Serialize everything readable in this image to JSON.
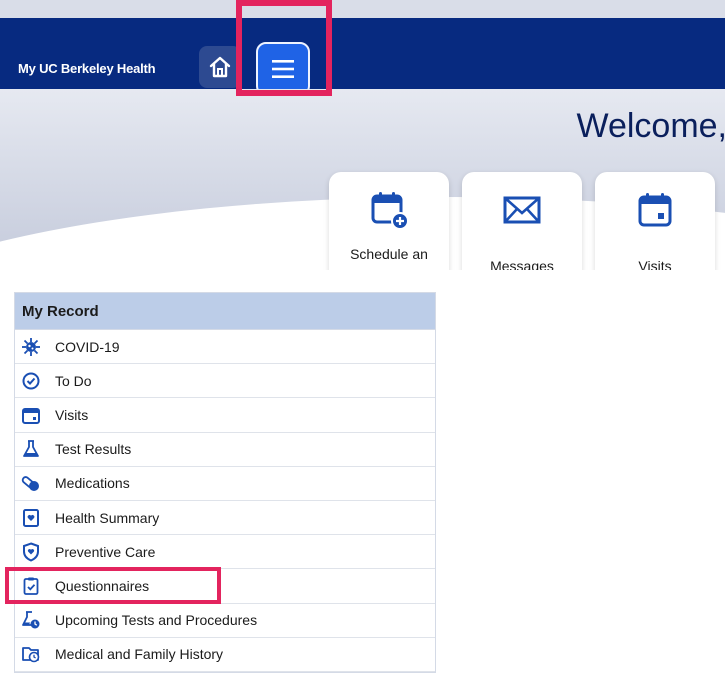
{
  "header": {
    "brand": "My UC Berkeley Health"
  },
  "hero": {
    "welcome": "Welcome,"
  },
  "cards": [
    {
      "label": "Schedule an",
      "icon": "calendar-plus-icon"
    },
    {
      "label": "Messages",
      "icon": "envelope-icon"
    },
    {
      "label": "Visits",
      "icon": "calendar-icon"
    }
  ],
  "menu": {
    "title": "My Record",
    "items": [
      {
        "label": "COVID-19",
        "icon": "virus-icon"
      },
      {
        "label": "To Do",
        "icon": "clock-check-icon"
      },
      {
        "label": "Visits",
        "icon": "calendar-icon"
      },
      {
        "label": "Test Results",
        "icon": "flask-icon"
      },
      {
        "label": "Medications",
        "icon": "pill-icon"
      },
      {
        "label": "Health Summary",
        "icon": "health-summary-icon"
      },
      {
        "label": "Preventive Care",
        "icon": "shield-icon"
      },
      {
        "label": "Questionnaires",
        "icon": "clipboard-check-icon"
      },
      {
        "label": "Upcoming Tests and Procedures",
        "icon": "flask-clock-icon"
      },
      {
        "label": "Medical and Family History",
        "icon": "folder-clock-icon"
      }
    ]
  },
  "colors": {
    "header": "#072a80",
    "accent": "#1f63e6",
    "highlight": "#e3245e",
    "menu_header": "#bccde8",
    "icon": "#1a4fb3"
  }
}
